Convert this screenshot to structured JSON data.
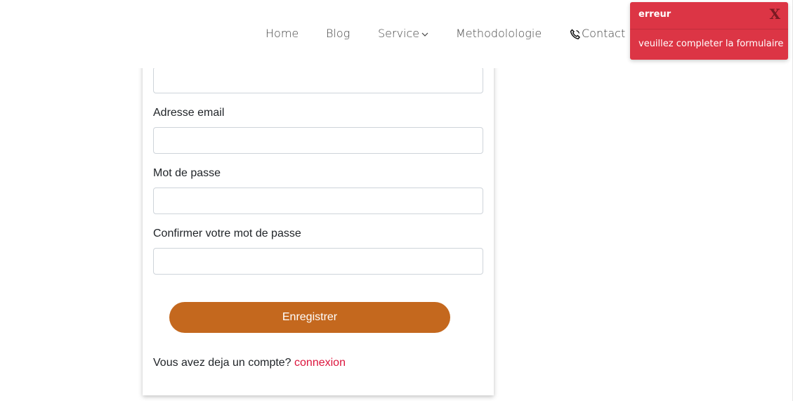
{
  "nav": {
    "home": "Home",
    "blog": "Blog",
    "service": "Service",
    "methodology": "Methodolologie",
    "contact": "Contact",
    "service_icon": "chevron-down-icon",
    "contact_icon": "phone-icon"
  },
  "form": {
    "email_label": "Adresse email",
    "password_label": "Mot de passe",
    "confirm_label": "Confirmer votre mot de passe",
    "name_value": "",
    "email_value": "",
    "password_value": "",
    "confirm_value": "",
    "submit_label": "Enregistrer",
    "login_prompt": "Vous avez deja un compte?",
    "login_link": "connexion"
  },
  "toast": {
    "title": "erreur",
    "close_label": "X",
    "message": "veuillez completer la formulaire"
  },
  "colors": {
    "accent": "#c4681e",
    "link": "#dc143c",
    "error": "#dc3545"
  }
}
